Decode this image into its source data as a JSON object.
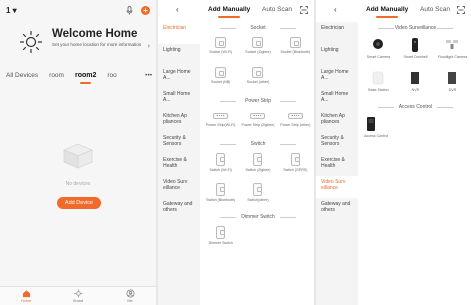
{
  "screen1": {
    "home_selector": "1 ▾",
    "welcome_title": "Welcome Home",
    "welcome_subtitle": "Set your home location for more information",
    "rooms": [
      "All Devices",
      "room",
      "room2",
      "roo"
    ],
    "active_room": "room2",
    "more": "•••",
    "empty_text": "No devices",
    "add_button": "Add Device",
    "tabs": [
      {
        "label": "Home",
        "icon": "home-icon",
        "active": true
      },
      {
        "label": "Smart",
        "icon": "sun-icon",
        "active": false
      },
      {
        "label": "Me",
        "icon": "person-icon",
        "active": false
      }
    ],
    "accent": "#f26a2a"
  },
  "screen2": {
    "back": "‹",
    "tab_manual": "Add Manually",
    "tab_scan": "Auto Scan",
    "categories": [
      "Electrician",
      "Lighting",
      "Large Home A...",
      "Small Home A...",
      "Kitchen Ap pliances",
      "Security & Sensors",
      "Exercise & Health",
      "Video Surv eillance",
      "Gateway and others"
    ],
    "active_category": "Electrician",
    "sections": [
      {
        "title": "Socket",
        "items": [
          "Socket (Wi-Fi)",
          "Socket (Zigbee)",
          "Socket (Bluetooth)",
          "Socket (NB)",
          "Socket (other)"
        ]
      },
      {
        "title": "Power Strip",
        "items": [
          "Power Strip(Wi-Fi)",
          "Power Strip (Zigbee)",
          "Power Strip (other)"
        ]
      },
      {
        "title": "Switch",
        "items": [
          "Switch (Wi-Fi)",
          "Switch (Zigbee)",
          "Switch (GPRS)",
          "Switch (Bluetooth)",
          "Switch(other)"
        ]
      },
      {
        "title": "Dimmer Switch",
        "items": [
          "Dimmer Switch"
        ]
      }
    ]
  },
  "screen3": {
    "back": "‹",
    "tab_manual": "Add Manually",
    "tab_scan": "Auto Scan",
    "categories": [
      "Electrician",
      "Lighting",
      "Large Home A...",
      "Small Home A...",
      "Kitchen Ap pliances",
      "Security & Sensors",
      "Exercise & Health",
      "Video Surv eillance",
      "Gateway and others"
    ],
    "active_category": "Video Surv eillance",
    "sections": [
      {
        "title": "Video Surveillance",
        "items": [
          "Smart Camera",
          "Smart Doorbell",
          "Floodlight Camera",
          "Base Station",
          "NVR",
          "DVR"
        ]
      },
      {
        "title": "Access Control",
        "items": [
          "Access Control"
        ]
      }
    ]
  }
}
